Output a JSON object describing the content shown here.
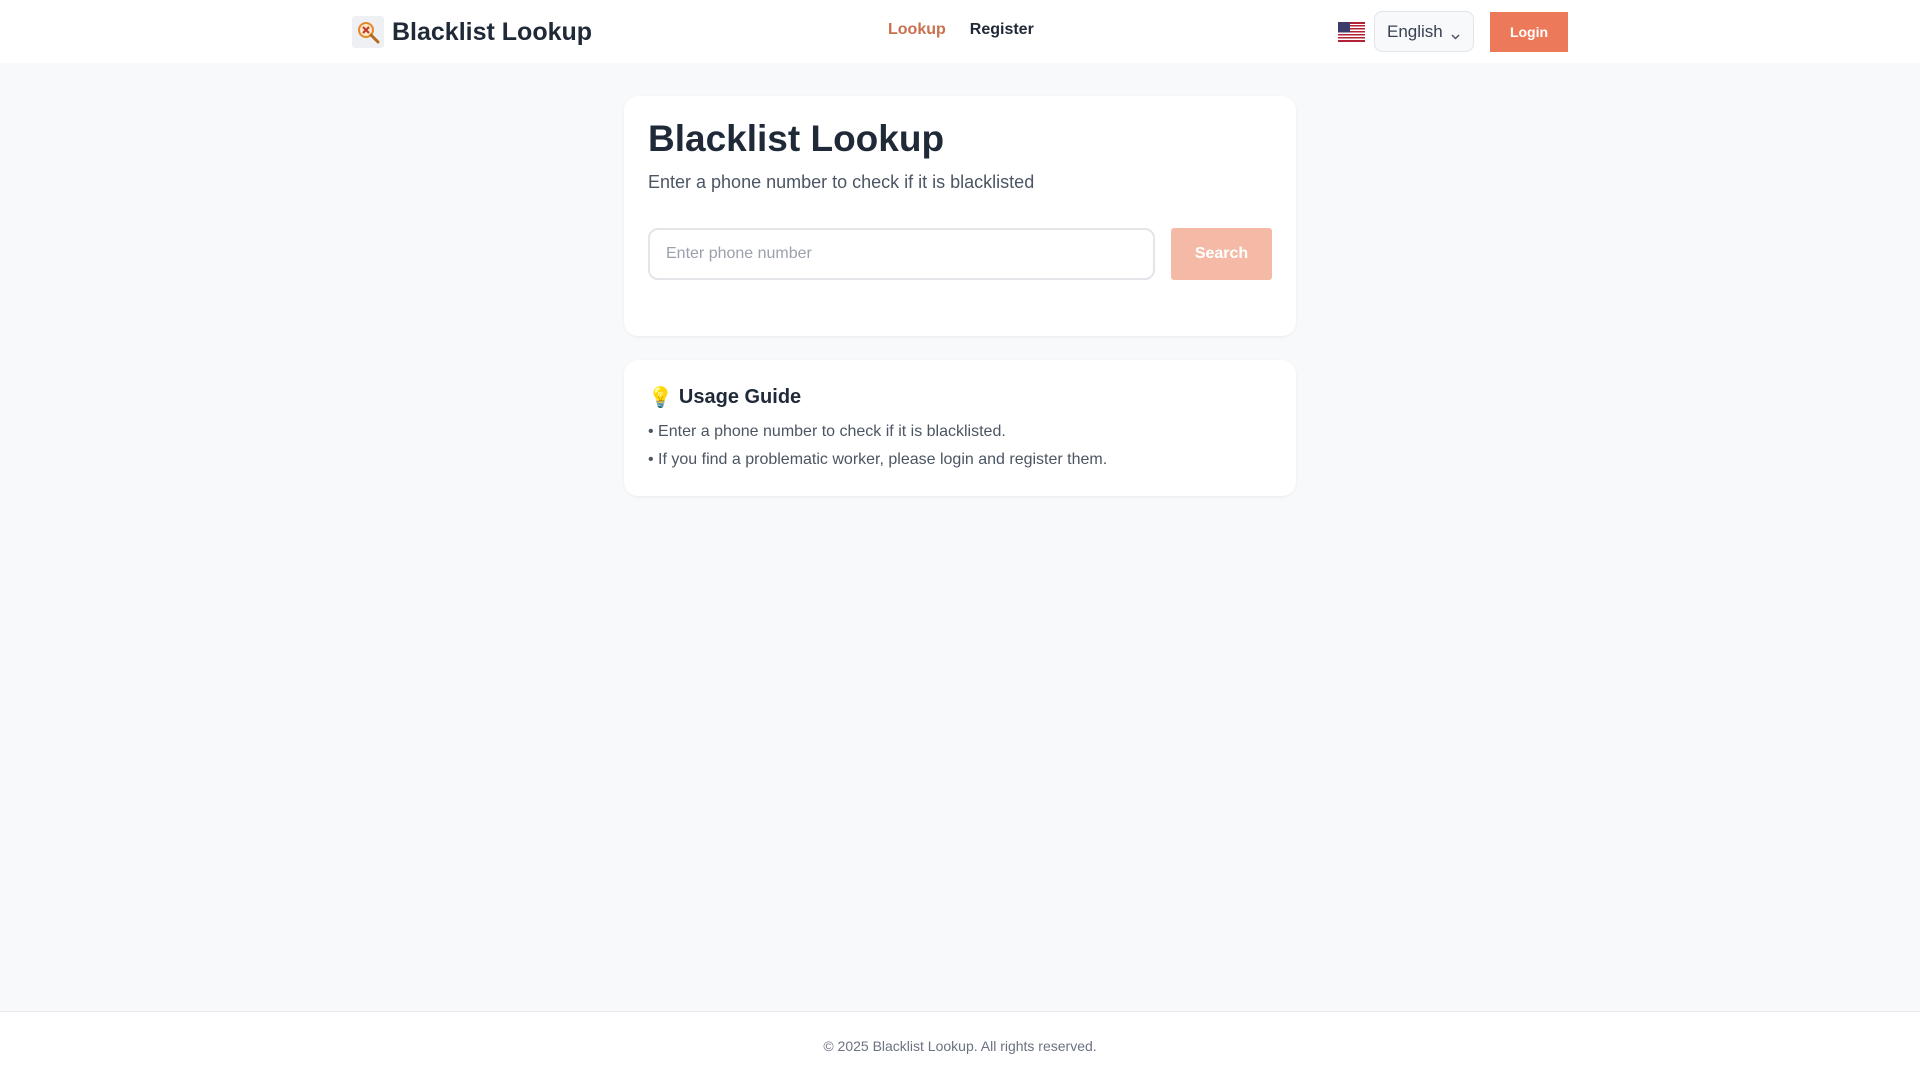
{
  "header": {
    "brand_title": "Blacklist Lookup",
    "nav": [
      {
        "label": "Lookup"
      },
      {
        "label": "Register"
      }
    ],
    "language": "English",
    "login_label": "Login"
  },
  "search_card": {
    "title": "Blacklist Lookup",
    "subtitle": "Enter a phone number to check if it is blacklisted",
    "input_placeholder": "Enter phone number",
    "input_value": "",
    "search_label": "Search"
  },
  "guide": {
    "icon": "💡",
    "title": "Usage Guide",
    "items": [
      "• Enter a phone number to check if it is blacklisted.",
      "• If you find a problematic worker, please login and register them."
    ]
  },
  "footer": {
    "text": "© 2025 Blacklist Lookup. All rights reserved."
  },
  "colors": {
    "accent": "#ec7a5a",
    "accent_light": "#f4baa6",
    "nav_active": "#c9704f",
    "background": "#f8f9fb"
  },
  "icons": [
    "magnifier-logo-icon",
    "us-flag-icon",
    "chevron-down-icon",
    "lightbulb-icon"
  ]
}
